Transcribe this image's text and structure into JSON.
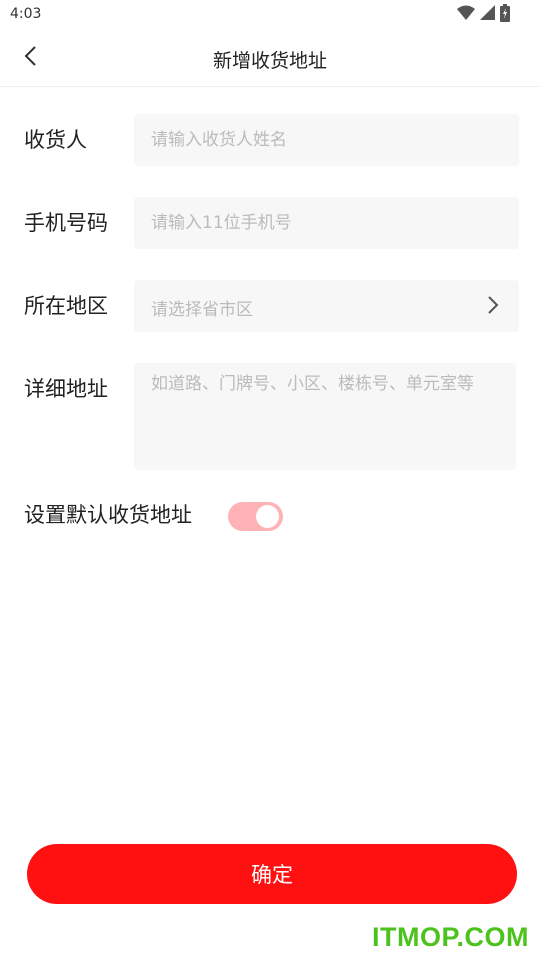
{
  "status_bar": {
    "time": "4:03",
    "icons": [
      "wifi-icon",
      "signal-icon",
      "battery-icon"
    ]
  },
  "nav": {
    "back_icon": "chevron-left-icon",
    "title": "新增收货地址"
  },
  "form": {
    "recipient": {
      "label": "收货人",
      "placeholder": "请输入收货人姓名",
      "value": ""
    },
    "phone": {
      "label": "手机号码",
      "placeholder": "请输入11位手机号",
      "value": ""
    },
    "region": {
      "label": "所在地区",
      "placeholder": "请选择省市区",
      "icon": "chevron-right-icon"
    },
    "address": {
      "label": "详细地址",
      "placeholder": "如道路、门牌号、小区、楼栋号、单元室等",
      "value": ""
    },
    "default_address": {
      "label": "设置默认收货地址",
      "enabled": true
    }
  },
  "confirm_button": {
    "label": "确定"
  },
  "watermark": "ITMOP.COM",
  "colors": {
    "accent": "#ff1111",
    "toggle_track": "#ffb3b6",
    "field_bg": "#f7f7f7",
    "placeholder": "#bbbbbb",
    "watermark": "#4cc21d"
  }
}
